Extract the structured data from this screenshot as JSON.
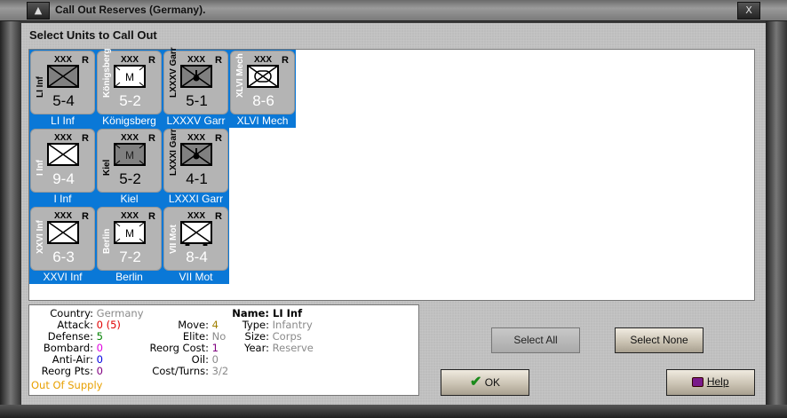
{
  "window": {
    "title": "Call Out Reserves (Germany).",
    "min_icon": "minimize-icon",
    "close_label": "X"
  },
  "heading": "Select Units to Call Out",
  "colors": {
    "selection": "#0a78d7",
    "card": "#b4b4b4",
    "dark_box": "#808080"
  },
  "units": [
    {
      "label": "LI Inf",
      "side": "LI Inf",
      "size": "XXX",
      "reserve": "R",
      "strength": "5-4",
      "type": "inf",
      "dark": true,
      "selected": true
    },
    {
      "label": "Königsberg",
      "side": "Königsberg",
      "size": "XXX",
      "reserve": "R",
      "strength": "5-2",
      "type": "m",
      "dark": false,
      "selected": true
    },
    {
      "label": "LXXXV Garr",
      "side": "LXXXV Garr",
      "size": "XXX",
      "reserve": "R",
      "strength": "5-1",
      "type": "garr",
      "dark": true,
      "selected": true
    },
    {
      "label": "XLVI Mech",
      "side": "XLVI Mech",
      "size": "XXX",
      "reserve": "R",
      "strength": "8-6",
      "type": "mech",
      "dark": false,
      "selected": true
    },
    {
      "label": "I Inf",
      "side": "I Inf",
      "size": "XXX",
      "reserve": "R",
      "strength": "9-4",
      "type": "inf",
      "dark": false,
      "selected": true
    },
    {
      "label": "Kiel",
      "side": "Kiel",
      "size": "XXX",
      "reserve": "R",
      "strength": "5-2",
      "type": "m",
      "dark": true,
      "selected": true
    },
    {
      "label": "LXXXI Garr",
      "side": "LXXXI Garr",
      "size": "XXX",
      "reserve": "R",
      "strength": "4-1",
      "type": "garr",
      "dark": true,
      "selected": true
    },
    {
      "label": "XXVI Inf",
      "side": "XXVI Inf",
      "size": "XXX",
      "reserve": "R",
      "strength": "6-3",
      "type": "inf",
      "dark": false,
      "selected": true
    },
    {
      "label": "Berlin",
      "side": "Berlin",
      "size": "XXX",
      "reserve": "R",
      "strength": "7-2",
      "type": "m",
      "dark": false,
      "selected": true
    },
    {
      "label": "VII Mot",
      "side": "VII Mot",
      "size": "XXX",
      "reserve": "R",
      "strength": "8-4",
      "type": "mot",
      "dark": false,
      "selected": true
    }
  ],
  "info": {
    "col1": [
      {
        "k": "Country:",
        "v": "Germany",
        "c": "#8a8a8a"
      },
      {
        "k": "Attack:",
        "v": "0 (5)",
        "c": "#e00000"
      },
      {
        "k": "Defense:",
        "v": "5",
        "c": "#008000"
      },
      {
        "k": "Bombard:",
        "v": "0",
        "c": "#e000e0"
      },
      {
        "k": "Anti-Air:",
        "v": "0",
        "c": "#0000e0"
      },
      {
        "k": "Reorg Pts:",
        "v": "0",
        "c": "#800080"
      }
    ],
    "supply": "Out Of Supply",
    "supply_color": "#e8a000",
    "col2": [
      {
        "k": "Move:",
        "v": "4",
        "c": "#a08000"
      },
      {
        "k": "Elite:",
        "v": "No",
        "c": "#8a8a8a"
      },
      {
        "k": "Reorg Cost:",
        "v": "1",
        "c": "#800080"
      },
      {
        "k": "Oil:",
        "v": "0",
        "c": "#8a8a8a"
      },
      {
        "k": "Cost/Turns:",
        "v": "3/2",
        "c": "#8a8a8a"
      }
    ],
    "name_label": "Name:",
    "name": "LI Inf",
    "col3": [
      {
        "k": "Type:",
        "v": "Infantry",
        "c": "#8a8a8a"
      },
      {
        "k": "Size:",
        "v": "Corps",
        "c": "#8a8a8a"
      },
      {
        "k": "Year:",
        "v": "Reserve",
        "c": "#8a8a8a"
      }
    ]
  },
  "buttons": {
    "select_all": "Select All",
    "select_none": "Select None",
    "ok": "OK",
    "help": "Help"
  }
}
